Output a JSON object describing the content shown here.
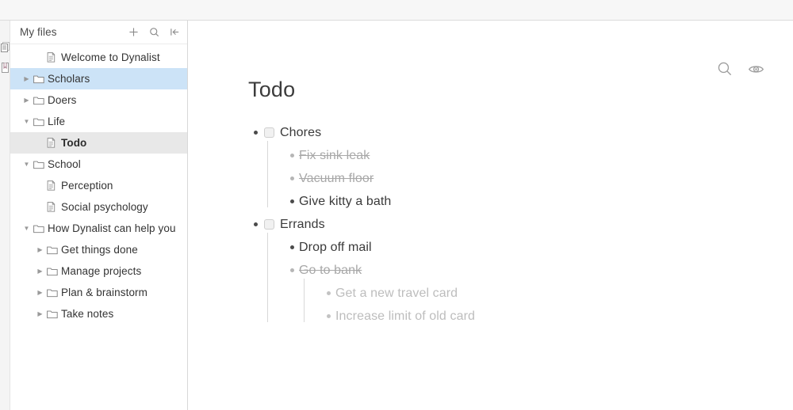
{
  "app": {
    "name": "Dynalist"
  },
  "rail": {
    "items": [
      {
        "name": "documents-icon",
        "label": "Documents"
      },
      {
        "name": "bookmarks-icon",
        "label": "Bookmarks"
      }
    ]
  },
  "sidebar": {
    "title": "My files",
    "actions": [
      {
        "name": "add-icon",
        "label": "New"
      },
      {
        "name": "search-icon",
        "label": "Search"
      },
      {
        "name": "collapse-sidebar-icon",
        "label": "Collapse sidebar"
      }
    ],
    "items": [
      {
        "label": "Welcome to Dynalist",
        "type": "document",
        "indent": 1,
        "arrow": "none",
        "state": "normal"
      },
      {
        "label": "Scholars",
        "type": "folder",
        "indent": 0,
        "arrow": "collapsed",
        "state": "hover"
      },
      {
        "label": "Doers",
        "type": "folder",
        "indent": 0,
        "arrow": "collapsed",
        "state": "normal"
      },
      {
        "label": "Life",
        "type": "folder",
        "indent": 0,
        "arrow": "expanded",
        "state": "normal"
      },
      {
        "label": "Todo",
        "type": "document",
        "indent": 1,
        "arrow": "none",
        "state": "selected"
      },
      {
        "label": "School",
        "type": "folder",
        "indent": 0,
        "arrow": "expanded",
        "state": "normal"
      },
      {
        "label": "Perception",
        "type": "document",
        "indent": 1,
        "arrow": "none",
        "state": "normal"
      },
      {
        "label": "Social psychology",
        "type": "document",
        "indent": 1,
        "arrow": "none",
        "state": "normal"
      },
      {
        "label": "How Dynalist can help you",
        "type": "folder",
        "indent": 0,
        "arrow": "expanded",
        "state": "normal"
      },
      {
        "label": "Get things done",
        "type": "folder",
        "indent": 1,
        "arrow": "collapsed",
        "state": "normal"
      },
      {
        "label": "Manage projects",
        "type": "folder",
        "indent": 1,
        "arrow": "collapsed",
        "state": "normal"
      },
      {
        "label": "Plan & brainstorm",
        "type": "folder",
        "indent": 1,
        "arrow": "collapsed",
        "state": "normal"
      },
      {
        "label": "Take notes",
        "type": "folder",
        "indent": 1,
        "arrow": "collapsed",
        "state": "normal"
      }
    ]
  },
  "main": {
    "actions": [
      {
        "name": "search-icon",
        "label": "Search"
      },
      {
        "name": "eye-icon",
        "label": "Toggle view"
      }
    ],
    "title": "Todo",
    "outline": [
      {
        "text": "Chores",
        "checkbox": true,
        "checked": false,
        "state": "normal",
        "children": [
          {
            "text": "Fix sink leak",
            "state": "done"
          },
          {
            "text": "Vacuum floor",
            "state": "done"
          },
          {
            "text": "Give kitty a bath",
            "state": "normal"
          }
        ]
      },
      {
        "text": "Errands",
        "checkbox": true,
        "checked": false,
        "state": "normal",
        "children": [
          {
            "text": "Drop off mail",
            "state": "normal"
          },
          {
            "text": "Go to bank",
            "state": "done",
            "children": [
              {
                "text": "Get a new travel card",
                "state": "faded"
              },
              {
                "text": "Increase limit of old card",
                "state": "faded"
              }
            ]
          }
        ]
      }
    ]
  },
  "colors": {
    "sidebar_hover": "#cce3f7",
    "sidebar_selected": "#e8e8e8",
    "text": "#3a3a3a",
    "done_text": "#a8a8a8",
    "faded_text": "#bdbdbd"
  }
}
